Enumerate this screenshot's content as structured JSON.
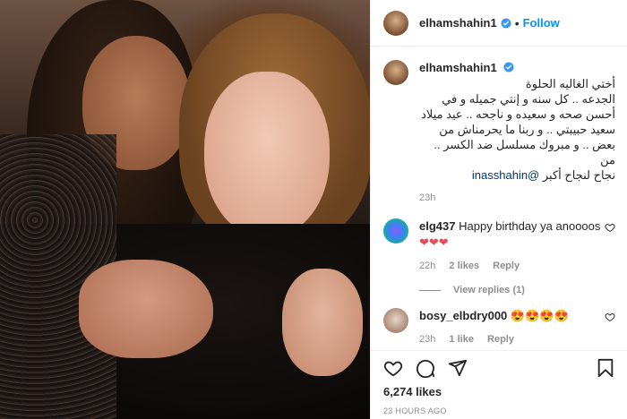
{
  "post": {
    "author": "elhamshahin1",
    "follow_label": "Follow",
    "separator": "•",
    "caption": {
      "lines": [
        "أختي الغاليه الحلوة",
        "الجدعه .. كل سنه و إنتي جميله و في",
        "أحسن صحه و سعيده و ناجحه .. عيد ميلاد",
        "سعيد حبيبتي .. و ربنا ما يحرمناش من",
        "بعض .. و مبروك مسلسل ضد الكسر .. من",
        "نجاح لنجاح أكبر"
      ],
      "mention": "@inasshahin",
      "time": "23h"
    },
    "comments": [
      {
        "user": "elg437",
        "text": "Happy birthday ya anoooos",
        "emoji": "❤❤❤",
        "time": "22h",
        "likes": "2 likes",
        "reply": "Reply",
        "view_replies": "View replies (1)"
      },
      {
        "user": "bosy_elbdry000",
        "text": "😍😍😍😍",
        "time": "23h",
        "likes": "1 like",
        "reply": "Reply"
      }
    ],
    "likes_count": "6,274 likes",
    "timestamp": "23 HOURS AGO"
  },
  "icons": {
    "verified": "verified-badge-icon",
    "like": "heart-icon",
    "comment": "comment-icon",
    "share": "paper-plane-icon",
    "save": "bookmark-icon"
  },
  "colors": {
    "link": "#0095f6",
    "mention": "#00376b",
    "muted": "#8e8e8e",
    "heart": "#ed4956"
  }
}
